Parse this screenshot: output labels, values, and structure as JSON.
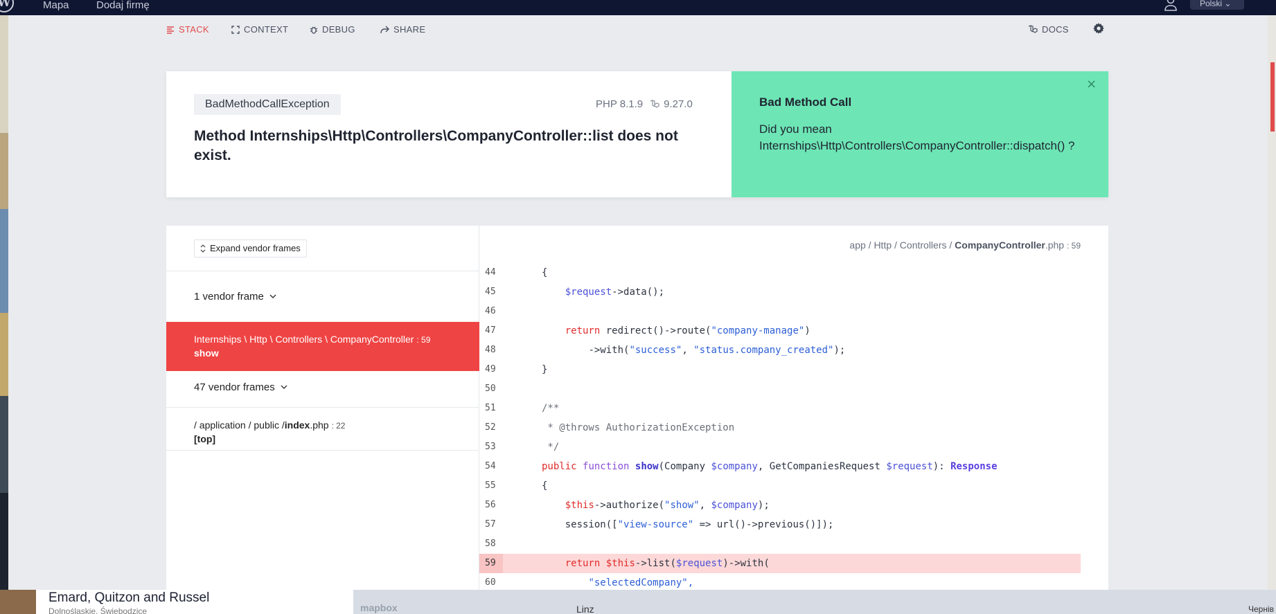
{
  "background_site": {
    "logo": "W",
    "nav": [
      "Mapa",
      "Dodaj firmę"
    ],
    "language": "Polski",
    "company_name": "Emard, Quitzon and Russel",
    "company_sub": "Dolnośląskie, Świebodzice",
    "map_brand": "mapbox",
    "map_city": "Linz",
    "map_label": "Чернів"
  },
  "topnav": {
    "stack": "STACK",
    "context": "CONTEXT",
    "debug": "DEBUG",
    "share": "SHARE",
    "docs": "DOCS"
  },
  "error": {
    "exception": "BadMethodCallException",
    "php_version": "PHP 8.1.9",
    "laravel_version": "9.27.0",
    "message": "Method Internships\\Http\\Controllers\\CompanyController::list does not exist."
  },
  "solution": {
    "title": "Bad Method Call",
    "body": "Did you mean Internships\\Http\\Controllers\\CompanyController::dispatch() ?",
    "close": "×"
  },
  "frames": {
    "expand_button": "Expand vendor frames",
    "vendor_group_1": "1 vendor frame",
    "active": {
      "path": "Internships \\ Http \\ Controllers \\ CompanyController",
      "line": ": 59",
      "method": "show"
    },
    "vendor_group_2": "47 vendor frames",
    "app_frame": {
      "dir": "/ application / public /",
      "file": "index",
      "ext": ".php",
      "line": ": 22",
      "method": "[top]"
    }
  },
  "code_view": {
    "file_dirs": "app / Http / Controllers /",
    "file_name": "CompanyController",
    "file_ext": ".php",
    "file_line": ": 59",
    "highlight_line": 59,
    "line_numbers": [
      "44",
      "45",
      "46",
      "47",
      "48",
      "49",
      "50",
      "51",
      "52",
      "53",
      "54",
      "55",
      "56",
      "57",
      "58",
      "59",
      "60"
    ],
    "lines": {
      "l44": "{",
      "l45_var": "$request",
      "l45_rest": "->data();",
      "l47_kw": "return",
      "l47_a": " redirect()->route(",
      "l47_str": "\"company-manage\"",
      "l47_b": ")",
      "l48_a": "->with(",
      "l48_s1": "\"success\"",
      "l48_b": ", ",
      "l48_s2": "\"status.company_created\"",
      "l48_c": ");",
      "l49": "}",
      "l51": "/**",
      "l52": " * @throws AuthorizationException",
      "l53": " */",
      "l54_public": "public",
      "l54_function": "function",
      "l54_name": "show",
      "l54_a": "(Company ",
      "l54_v1": "$company",
      "l54_b": ", GetCompaniesRequest ",
      "l54_v2": "$request",
      "l54_c": "): ",
      "l54_type": "Response",
      "l55": "{",
      "l56_this": "$this",
      "l56_a": "->authorize(",
      "l56_str": "\"show\"",
      "l56_b": ", ",
      "l56_var": "$company",
      "l56_c": ");",
      "l57_a": "session([",
      "l57_str": "\"view-source\"",
      "l57_b": " => url()->previous()]);",
      "l59_kw": "return",
      "l59_this": "$this",
      "l59_a": "->list(",
      "l59_var": "$request",
      "l59_b": ")->with(",
      "l60_str": "\"selectedCompany\","
    }
  },
  "colors": {
    "accent_red": "#ef4444",
    "solution_green": "#6de5b5",
    "highlight_line": "#fdd8d8"
  }
}
